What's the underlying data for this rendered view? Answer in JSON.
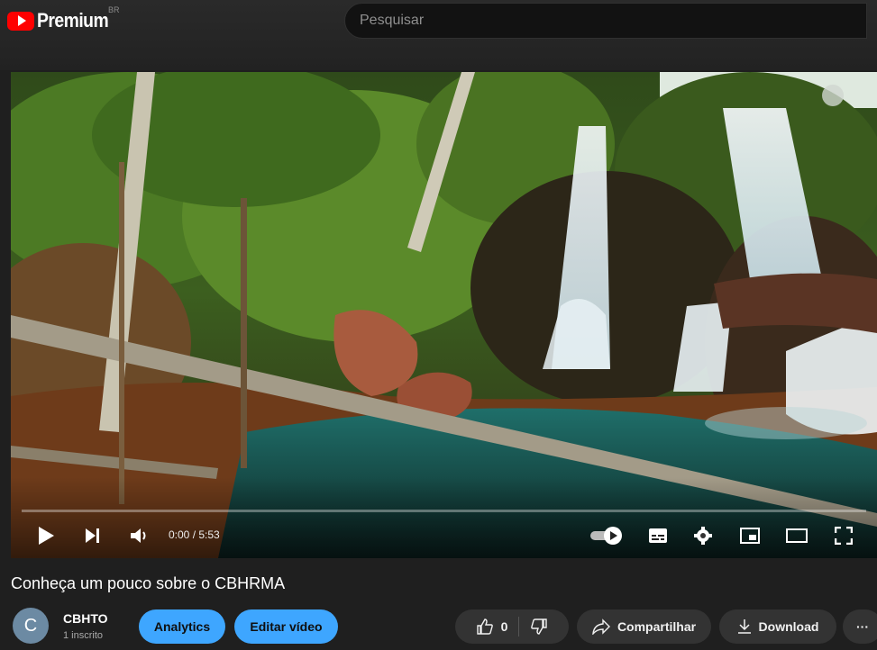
{
  "header": {
    "logo_text": "Premium",
    "region": "BR",
    "search_placeholder": "Pesquisar"
  },
  "player": {
    "time_current": "0:00",
    "time_separator": " / ",
    "time_total": "5:53",
    "progress": 0
  },
  "video": {
    "title": "Conheça um pouco sobre o CBHRMA"
  },
  "channel": {
    "avatar_letter": "C",
    "name": "CBHTO",
    "subscribers": "1 inscrito"
  },
  "actions": {
    "analytics": "Analytics",
    "edit": "Editar vídeo",
    "likes": "0",
    "share": "Compartilhar",
    "download": "Download",
    "more": "···"
  },
  "colors": {
    "brand": "#ff0000",
    "accent": "#3ea6ff",
    "background": "#1f1f1f"
  }
}
